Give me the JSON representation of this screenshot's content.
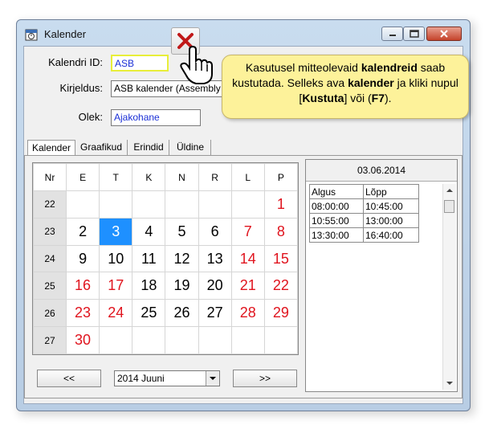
{
  "window": {
    "title": "Kalender"
  },
  "form": {
    "id_label": "Kalendri ID:",
    "id_value": "ASB",
    "desc_label": "Kirjeldus:",
    "desc_value": "ASB kalender (Assembly S",
    "status_label": "Olek:",
    "status_value": "Ajakohane"
  },
  "tabs": [
    "Kalender",
    "Graafikud",
    "Erindid",
    "Üldine"
  ],
  "calendar": {
    "headers": [
      "Nr",
      "E",
      "T",
      "K",
      "N",
      "R",
      "L",
      "P"
    ],
    "rows": [
      {
        "nr": "22",
        "days": [
          "",
          "",
          "",
          "",
          "",
          "",
          "1"
        ]
      },
      {
        "nr": "23",
        "days": [
          "2",
          "3",
          "4",
          "5",
          "6",
          "7",
          "8"
        ]
      },
      {
        "nr": "24",
        "days": [
          "9",
          "10",
          "11",
          "12",
          "13",
          "14",
          "15"
        ]
      },
      {
        "nr": "25",
        "days": [
          "16",
          "17",
          "18",
          "19",
          "20",
          "21",
          "22"
        ]
      },
      {
        "nr": "26",
        "days": [
          "23",
          "24",
          "25",
          "26",
          "27",
          "28",
          "29"
        ]
      },
      {
        "nr": "27",
        "days": [
          "30",
          "",
          "",
          "",
          "",
          "",
          ""
        ]
      }
    ],
    "selected_day": "3",
    "colors": {
      "holiday": "#e0141e",
      "selected": "#1e90ff"
    }
  },
  "times": {
    "date": "03.06.2014",
    "headers": [
      "Algus",
      "Lõpp"
    ],
    "rows": [
      [
        "08:00:00",
        "10:45:00"
      ],
      [
        "10:55:00",
        "13:00:00"
      ],
      [
        "13:30:00",
        "16:40:00"
      ]
    ]
  },
  "nav": {
    "prev": "<<",
    "month": "2014 Juuni",
    "next": ">>"
  },
  "tooltip": {
    "t1": "Kasutusel mitteolevaid ",
    "b1": "kalendreid",
    "t2": " saab kustutada. Selleks ava ",
    "b2": "kalender",
    "t3": " ja kliki nupul [",
    "b3": "Kustuta",
    "t4": "] või (",
    "b4": "F7",
    "t5": ")."
  },
  "icons": {
    "delete": "red-x-icon",
    "cursor": "hand-cursor-icon"
  }
}
